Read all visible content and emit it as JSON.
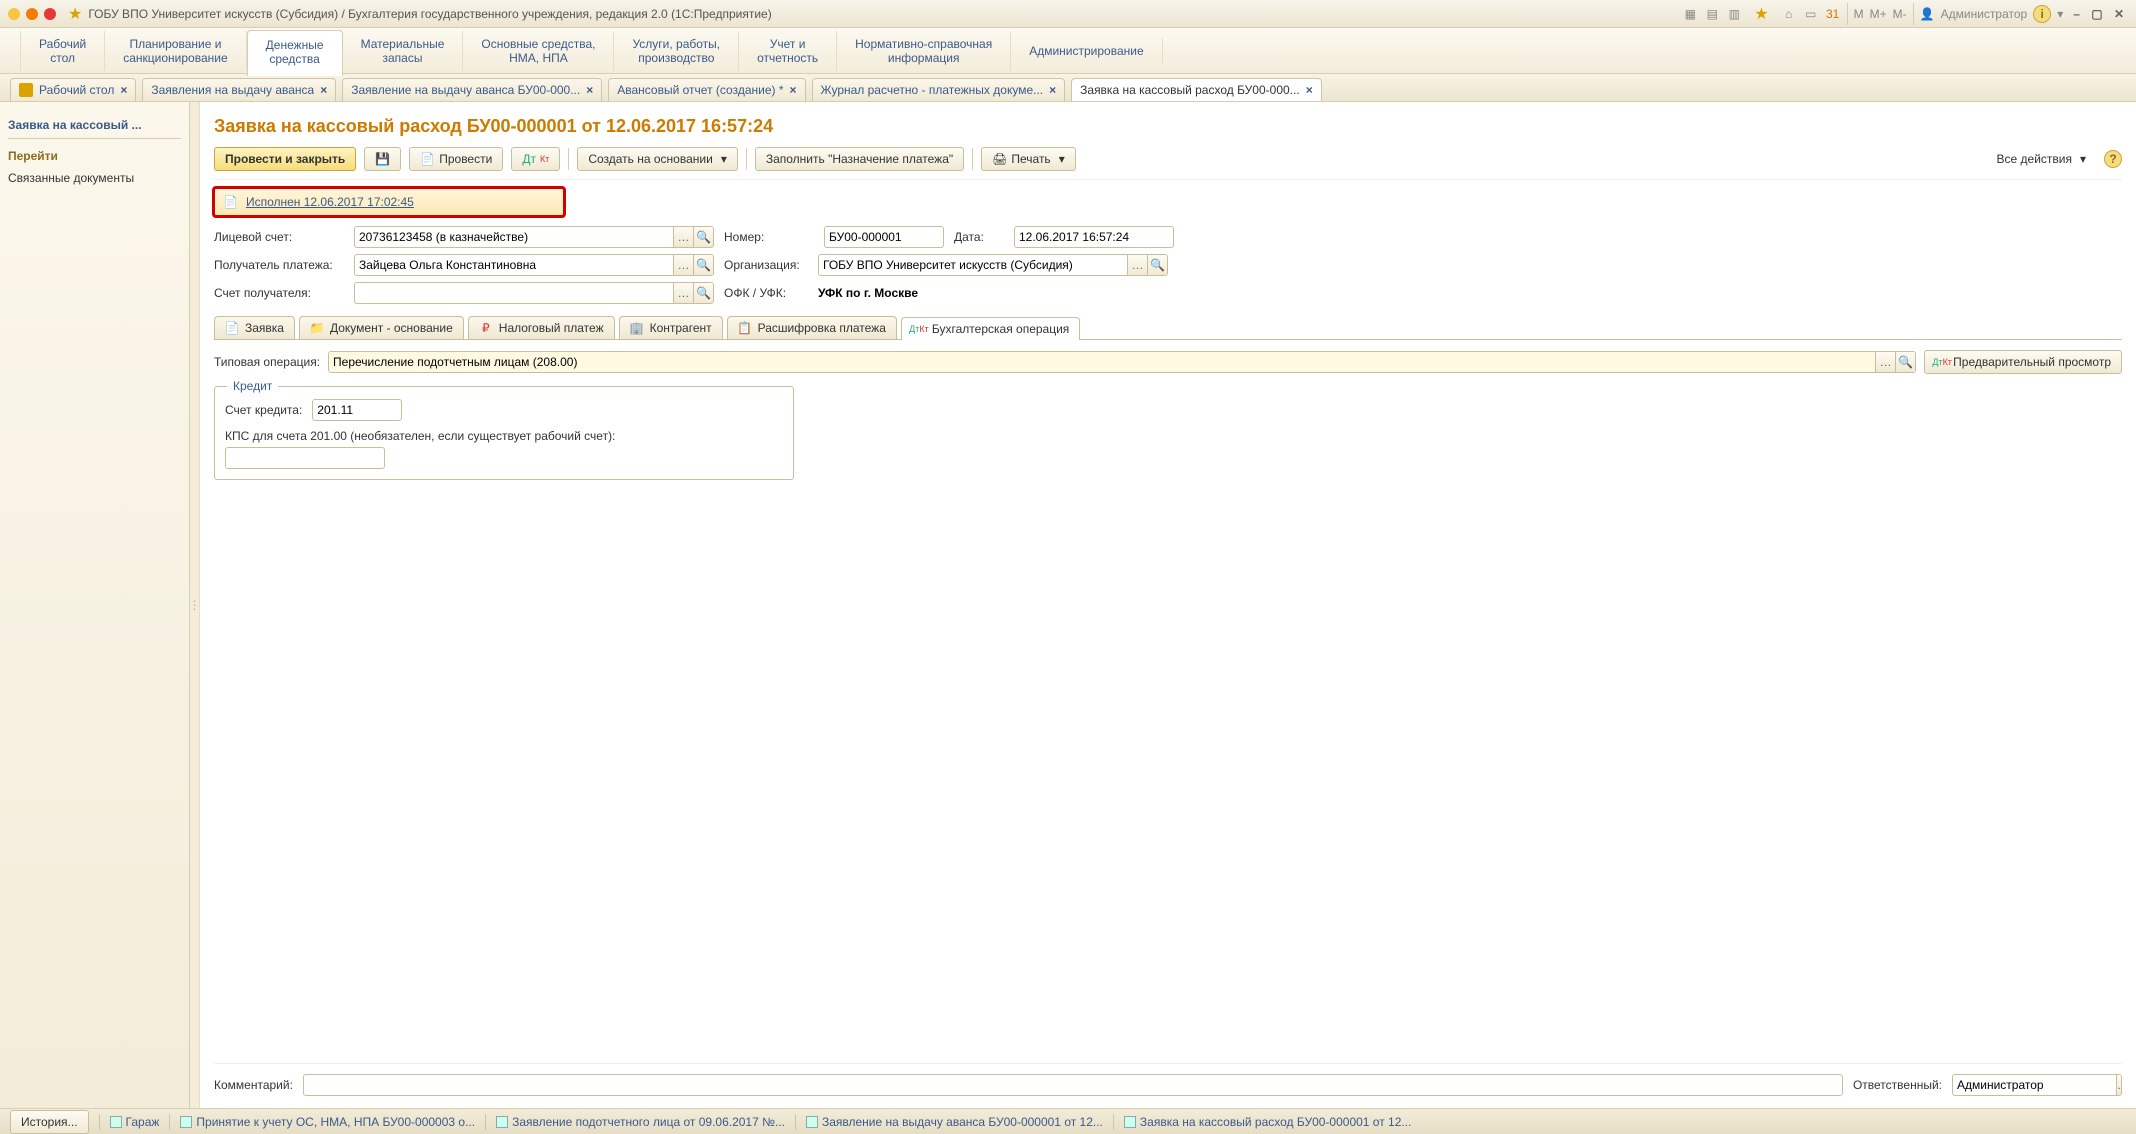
{
  "window": {
    "title": "ГОБУ ВПО Университет искусств (Субсидия) / Бухгалтерия государственного учреждения, редакция 2.0  (1С:Предприятие)",
    "user_label": "Администратор",
    "mm_labels": [
      "M",
      "M+",
      "M-"
    ]
  },
  "sections": [
    {
      "l1": "Рабочий",
      "l2": "стол"
    },
    {
      "l1": "Планирование и",
      "l2": "санкционирование"
    },
    {
      "l1": "Денежные",
      "l2": "средства"
    },
    {
      "l1": "Материальные",
      "l2": "запасы"
    },
    {
      "l1": "Основные средства,",
      "l2": "НМА, НПА"
    },
    {
      "l1": "Услуги, работы,",
      "l2": "производство"
    },
    {
      "l1": "Учет и",
      "l2": "отчетность"
    },
    {
      "l1": "Нормативно-справочная",
      "l2": "информация"
    },
    {
      "l1": "Администрирование",
      "l2": ""
    }
  ],
  "tabs": [
    {
      "label": "Рабочий стол"
    },
    {
      "label": "Заявления на выдачу аванса"
    },
    {
      "label": "Заявление на выдачу аванса БУ00-000..."
    },
    {
      "label": "Авансовый отчет (создание) *"
    },
    {
      "label": "Журнал расчетно - платежных докуме..."
    },
    {
      "label": "Заявка на кассовый расход БУ00-000..."
    }
  ],
  "sidebar": {
    "title": "Заявка на кассовый ...",
    "section": "Перейти",
    "links": [
      "Связанные документы"
    ]
  },
  "page": {
    "title": "Заявка на кассовый расход БУ00-000001 от 12.06.2017 16:57:24"
  },
  "toolbar": {
    "provest_close": "Провести и закрыть",
    "provest": "Провести",
    "create_based": "Создать на основании",
    "fill_purpose": "Заполнить \"Назначение платежа\"",
    "print": "Печать",
    "all_actions": "Все действия"
  },
  "status": {
    "text": "Исполнен 12.06.2017 17:02:45"
  },
  "form": {
    "account_label": "Лицевой счет:",
    "account_value": "20736123458 (в казначействе)",
    "number_label": "Номер:",
    "number_value": "БУ00-000001",
    "date_label": "Дата:",
    "date_value": "12.06.2017 16:57:24",
    "payer_label": "Получатель платежа:",
    "payer_value": "Зайцева Ольга Константиновна",
    "org_label": "Организация:",
    "org_value": "ГОБУ ВПО Университет искусств (Субсидия)",
    "recipient_acc_label": "Счет получателя:",
    "recipient_acc_value": "",
    "ofk_label": "ОФК / УФК:",
    "ofk_value": "УФК по г. Москве"
  },
  "subtabs": [
    "Заявка",
    "Документ - основание",
    "Налоговый платеж",
    "Контрагент",
    "Расшифровка платежа",
    "Бухгалтерская операция"
  ],
  "operation": {
    "label": "Типовая операция:",
    "value": "Перечисление подотчетным лицам (208.00)",
    "preview": "Предварительный просмотр"
  },
  "credit": {
    "legend": "Кредит",
    "account_label": "Счет кредита:",
    "account_value": "201.11",
    "kps_label": "КПС для счета 201.00 (необязателен, если существует рабочий счет):",
    "kps_value": ""
  },
  "footer": {
    "comment_label": "Комментарий:",
    "comment_value": "",
    "responsible_label": "Ответственный:",
    "responsible_value": "Администратор"
  },
  "taskbar": {
    "history": "История...",
    "items": [
      "Гараж",
      "Принятие к учету ОС, НМА, НПА БУ00-000003 о...",
      "Заявление подотчетного лица от 09.06.2017 №...",
      "Заявление на выдачу аванса БУ00-000001 от 12...",
      "Заявка на кассовый расход БУ00-000001 от 12..."
    ]
  }
}
